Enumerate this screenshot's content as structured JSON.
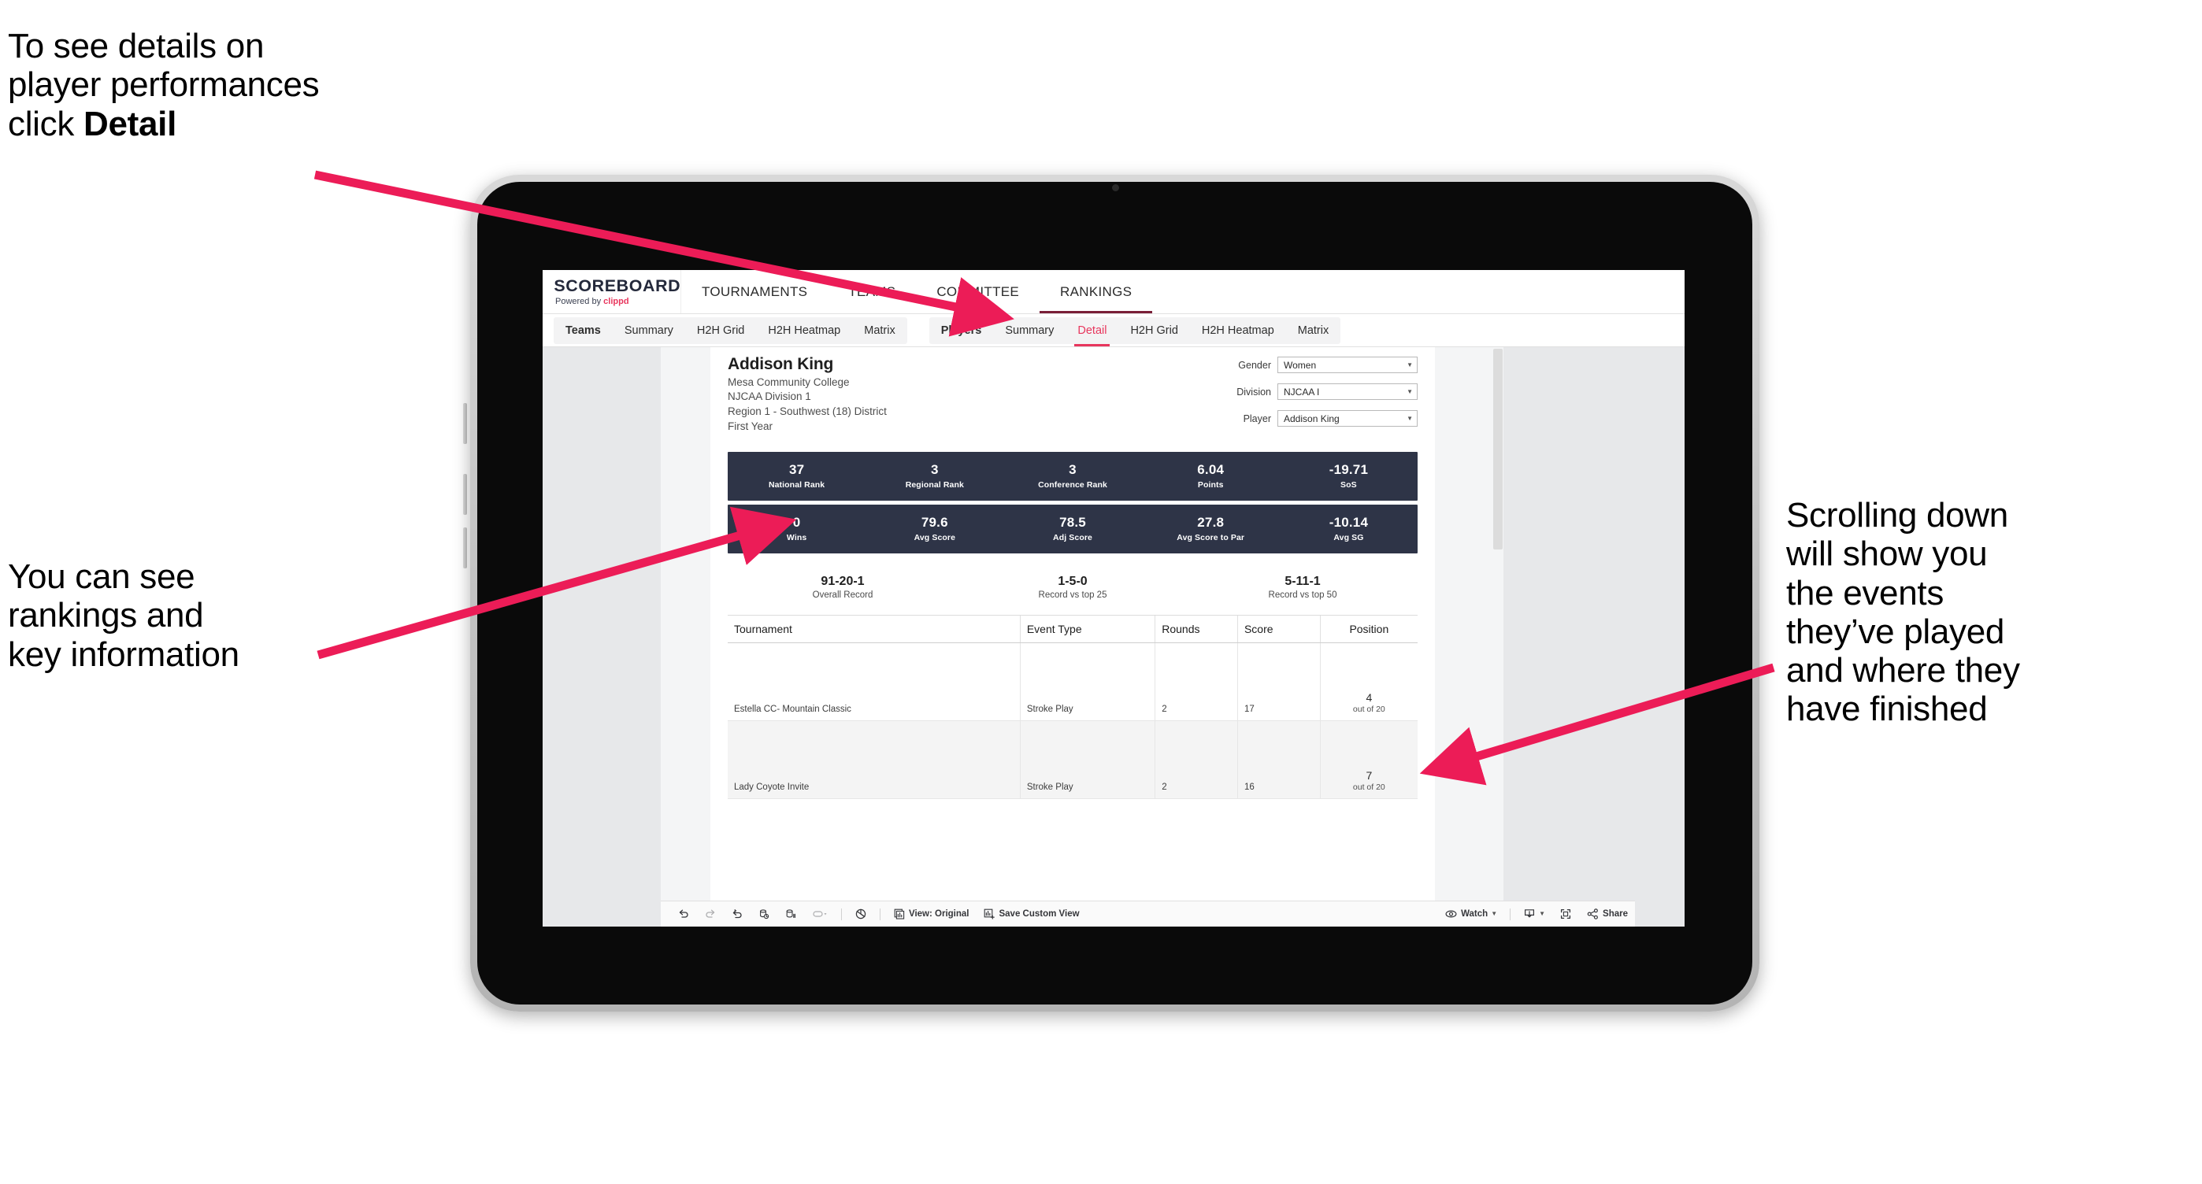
{
  "annotations": {
    "top_left": {
      "lines": [
        "To see details on",
        "player performances",
        "click "
      ],
      "bold_word": "Detail"
    },
    "bottom_left": {
      "text": "You can see\nrankings and\nkey information"
    },
    "right": {
      "text": "Scrolling down\nwill show you\nthe events\nthey’ve played\nand where they\nhave finished"
    }
  },
  "colors": {
    "accent": "#e8365d",
    "band": "#2e3447",
    "nav_active": "#7a1f38"
  },
  "app": {
    "brand": {
      "title": "SCOREBOARD",
      "powered_prefix": "Powered by ",
      "powered_name": "clippd"
    },
    "nav": [
      {
        "label": "TOURNAMENTS",
        "active": false
      },
      {
        "label": "TEAMS",
        "active": false
      },
      {
        "label": "COMMITTEE",
        "active": false
      },
      {
        "label": "RANKINGS",
        "active": true
      }
    ],
    "tab_group_teams": [
      {
        "label": "Teams",
        "bold": true,
        "active": false
      },
      {
        "label": "Summary",
        "bold": false,
        "active": false
      },
      {
        "label": "H2H Grid",
        "bold": false,
        "active": false
      },
      {
        "label": "H2H Heatmap",
        "bold": false,
        "active": false
      },
      {
        "label": "Matrix",
        "bold": false,
        "active": false
      }
    ],
    "tab_group_players": [
      {
        "label": "Players",
        "bold": true,
        "active": false
      },
      {
        "label": "Summary",
        "bold": false,
        "active": false
      },
      {
        "label": "Detail",
        "bold": false,
        "active": true
      },
      {
        "label": "H2H Grid",
        "bold": false,
        "active": false
      },
      {
        "label": "H2H Heatmap",
        "bold": false,
        "active": false
      },
      {
        "label": "Matrix",
        "bold": false,
        "active": false
      }
    ]
  },
  "player": {
    "name": "Addison King",
    "school": "Mesa Community College",
    "division": "NJCAA Division 1",
    "region": "Region 1 - Southwest (18) District",
    "year": "First Year"
  },
  "filters": [
    {
      "label": "Gender",
      "value": "Women"
    },
    {
      "label": "Division",
      "value": "NJCAA I"
    },
    {
      "label": "Player",
      "value": "Addison King"
    }
  ],
  "stats_band_1": [
    {
      "value": "37",
      "label": "National Rank"
    },
    {
      "value": "3",
      "label": "Regional Rank"
    },
    {
      "value": "3",
      "label": "Conference Rank"
    },
    {
      "value": "6.04",
      "label": "Points"
    },
    {
      "value": "-19.71",
      "label": "SoS"
    }
  ],
  "stats_band_2": [
    {
      "value": "0",
      "label": "Wins"
    },
    {
      "value": "79.6",
      "label": "Avg Score"
    },
    {
      "value": "78.5",
      "label": "Adj Score"
    },
    {
      "value": "27.8",
      "label": "Avg Score to Par"
    },
    {
      "value": "-10.14",
      "label": "Avg SG"
    }
  ],
  "records": [
    {
      "value": "91-20-1",
      "label": "Overall Record"
    },
    {
      "value": "1-5-0",
      "label": "Record vs top 25"
    },
    {
      "value": "5-11-1",
      "label": "Record vs top 50"
    }
  ],
  "table": {
    "headers": [
      "Tournament",
      "Event Type",
      "Rounds",
      "Score",
      "Position"
    ],
    "rows": [
      {
        "tournament": "Estella CC- Mountain Classic",
        "event_type": "Stroke Play",
        "rounds": "2",
        "score": "17",
        "position": "4",
        "position_of": "out of 20"
      },
      {
        "tournament": "Lady Coyote Invite",
        "event_type": "Stroke Play",
        "rounds": "2",
        "score": "16",
        "position": "7",
        "position_of": "out of 20"
      }
    ]
  },
  "toolbar": {
    "view_label": "View: Original",
    "save_label": "Save Custom View",
    "watch_label": "Watch",
    "share_label": "Share"
  }
}
